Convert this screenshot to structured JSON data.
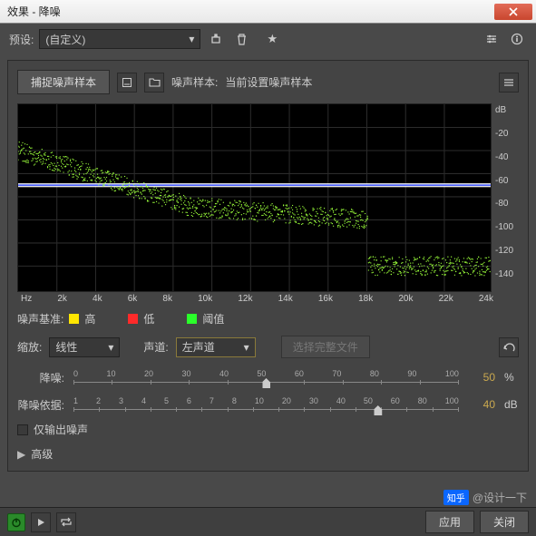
{
  "window": {
    "title": "效果 - 降噪"
  },
  "preset": {
    "label": "预设:",
    "value": "(自定义)"
  },
  "capture": {
    "button": "捕捉噪声样本",
    "noise_sample_label": "噪声样本:",
    "noise_sample_status": "当前设置噪声样本"
  },
  "plot": {
    "x_unit": "Hz",
    "y_unit": "dB",
    "x_ticks": [
      "2k",
      "4k",
      "6k",
      "8k",
      "10k",
      "12k",
      "14k",
      "16k",
      "18k",
      "20k",
      "22k",
      "24k"
    ],
    "y_ticks": [
      "dB",
      "-20",
      "-40",
      "-60",
      "-80",
      "-100",
      "-120",
      "-140"
    ]
  },
  "legend": {
    "title": "噪声基准:",
    "high": "高",
    "low": "低",
    "threshold": "阈值"
  },
  "scale": {
    "label": "缩放:",
    "value": "线性",
    "channel_label": "声道:",
    "channel_value": "左声道",
    "select_file_btn": "选择完整文件"
  },
  "sliders": {
    "nr": {
      "label": "降噪:",
      "ticks": [
        "0",
        "10",
        "20",
        "30",
        "40",
        "50",
        "60",
        "70",
        "80",
        "90",
        "100"
      ],
      "value": 50,
      "unit": "%"
    },
    "by": {
      "label": "降噪依据:",
      "ticks": [
        "1",
        "2",
        "3",
        "4",
        "5",
        "6",
        "7",
        "8",
        "10",
        "20",
        "30",
        "40",
        "50",
        "60",
        "80",
        "100"
      ],
      "value": 40,
      "unit": "dB"
    }
  },
  "output_noise_only": {
    "label": "仅输出噪声",
    "checked": false
  },
  "advanced": {
    "label": "高级"
  },
  "footer": {
    "apply": "应用",
    "close": "关闭"
  },
  "watermark": {
    "brand": "知乎",
    "text": "@设计一下"
  }
}
